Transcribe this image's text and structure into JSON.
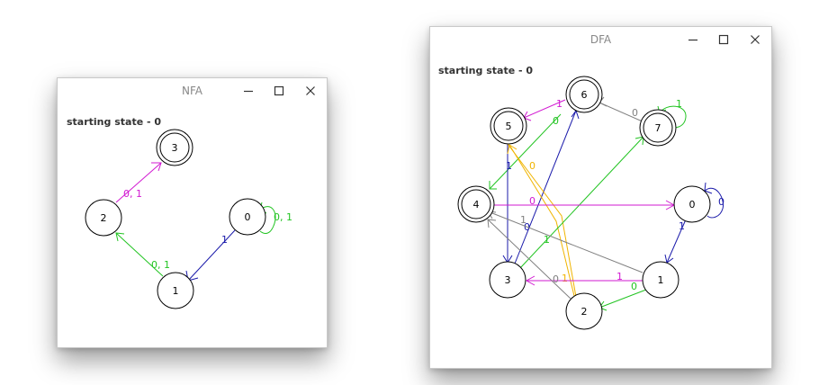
{
  "nfa": {
    "title": "NFA",
    "starting_label": "starting state - 0",
    "states": [
      "0",
      "1",
      "2",
      "3"
    ],
    "edge_labels": {
      "e_0_0": "0, 1",
      "e_0_1": "1",
      "e_1_2": "0, 1",
      "e_2_3": "0, 1"
    }
  },
  "dfa": {
    "title": "DFA",
    "starting_label": "starting state - 0",
    "states": [
      "0",
      "1",
      "2",
      "3",
      "4",
      "5",
      "6",
      "7"
    ],
    "edge_labels": {
      "e_0_0": "0",
      "e_0_1": "1",
      "e_0_4": "0",
      "e_1_2": "0",
      "e_1_3": "1",
      "e_1_4": "1",
      "e_2_4": "0",
      "e_2_5_a": "1",
      "e_2_5_b": "0",
      "e_3_6": "0",
      "e_3_7": "1",
      "e_5_3": "1",
      "e_6_5": "1",
      "e_5_4": "0",
      "e_7_6": "0",
      "e_7_7": "1"
    }
  },
  "colors": {
    "green": "#22c422",
    "blue": "#1a1aaa",
    "magenta": "#d21ad2",
    "gray": "#808080",
    "orange": "#f0b400"
  },
  "icons": [
    "minimize-icon",
    "maximize-icon",
    "close-icon"
  ]
}
